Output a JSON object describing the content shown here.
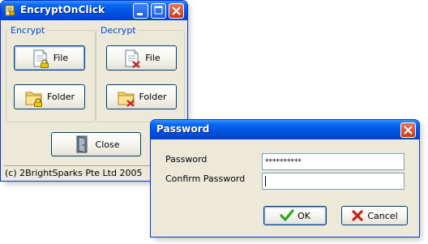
{
  "main_window": {
    "title": "EncryptOnClick",
    "encrypt_group": {
      "label": "Encrypt",
      "file_button": "File",
      "folder_button": "Folder"
    },
    "decrypt_group": {
      "label": "Decrypt",
      "file_button": "File",
      "folder_button": "Folder"
    },
    "close_button": "Close",
    "status_text": "(c) 2BrightSparks Pte Ltd 2005"
  },
  "password_dialog": {
    "title": "Password",
    "password_label": "Password",
    "password_value": "**********",
    "confirm_label": "Confirm Password",
    "confirm_value": "",
    "ok_button": "OK",
    "cancel_button": "Cancel"
  },
  "colors": {
    "titlebar": "#0054e3",
    "window_face": "#ece9d8",
    "group_label": "#0046d5",
    "ok_check": "#2aa81f",
    "cancel_x": "#c8201c"
  }
}
